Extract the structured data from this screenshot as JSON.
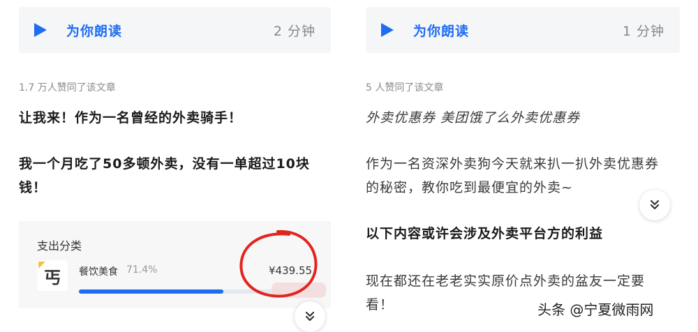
{
  "left_article": {
    "listen": {
      "label": "为你朗读",
      "duration": "2 分钟"
    },
    "likes": "1.7 万人赞同了该文章",
    "paragraphs": [
      "让我来！作为一名曾经的外卖骑手！",
      "我一个月吃了50多顿外卖，没有一单超过10块钱！"
    ],
    "spend_card": {
      "title": "支出分类",
      "category": "餐饮美食",
      "percent": "71.4%",
      "percent_value": 71.4,
      "amount": "¥439.55",
      "icon_glyph": "丐"
    },
    "expand_icon": "double-chevron-down-icon"
  },
  "right_article": {
    "listen": {
      "label": "为你朗读",
      "duration": "1 分钟"
    },
    "likes": "5 人赞同了该文章",
    "paragraphs": [
      "外卖优惠券 美团饿了么外卖优惠券",
      "作为一名资深外卖狗今天就来扒一扒外卖优惠券的秘密，教你吃到最便宜的外卖~",
      "以下内容或许会涉及外卖平台方的利益",
      "现在都还在老老实实原价点外卖的盆友一定要看！"
    ],
    "expand_icon": "double-chevron-down-icon"
  },
  "watermark": "头条 @宁夏微雨网",
  "colors": {
    "accent": "#1e6cf2",
    "annotation": "#e0251e",
    "panel_bg": "#f5f6f8"
  }
}
